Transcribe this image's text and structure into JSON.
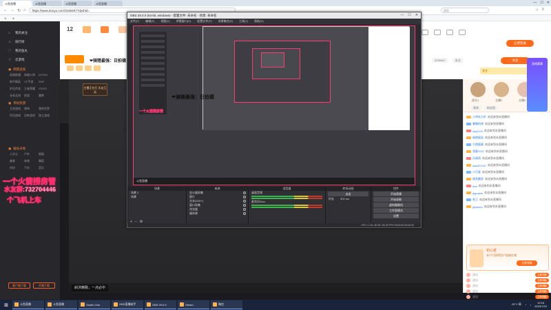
{
  "browser": {
    "tabs": [
      "斗鱼直播",
      "斗鱼直播",
      "斗鱼直播",
      "斗鱼直播"
    ],
    "url": "https://www.douyu.com/3236467?dyshid=",
    "search_placeholder": "搜索",
    "controls": [
      "—",
      "☐",
      "✕"
    ]
  },
  "sidebar": {
    "items": [
      {
        "icon": "home-icon",
        "label": "我的关注"
      },
      {
        "icon": "fire-icon",
        "label": "排行榜"
      },
      {
        "icon": "heart-icon",
        "label": "我的鱼丸"
      },
      {
        "icon": "star-icon",
        "label": "云游戏"
      }
    ],
    "section1": "网游竞技",
    "grid1": [
      "英雄联盟",
      "穿越火线",
      "DOTA2",
      "和平精英",
      "CF手游",
      "DNF",
      "炉石传说",
      "王者荣耀",
      "CSGO",
      "永劫无间",
      "逆战",
      "魔兽"
    ],
    "section2": "单机热游",
    "grid2": [
      "主机游戏",
      "原神",
      "我的世界",
      "怀旧游戏",
      "恐怖游戏",
      "独立游戏"
    ],
    "section3": "娱乐天地",
    "grid3": [
      "二次元",
      "户外",
      "颜值",
      "美食",
      "体育",
      "舞蹈",
      "科技",
      "汽车",
      "音乐"
    ],
    "bottom_buttons": [
      "客户端下载",
      "开播下载"
    ]
  },
  "header": {
    "nav_number": "12",
    "room_title": "❤骑猪最强：日拍德",
    "login": "立即登录",
    "follow": "关注",
    "anchor_chip": "关注",
    "room_code": "3236467"
  },
  "overlay": {
    "line1": "一个火箭捞房管",
    "line2": "水友群:732704446",
    "line3": "个飞机上车",
    "anchor_tag": "主播正在打\n水友互动"
  },
  "obs": {
    "title": "OBS 29.0.0 (64-bit, windows) - 配置文件: 未命名 - 场景: 未命名",
    "menu": [
      "文件(F)",
      "编辑(E)",
      "视图(V)",
      "停靠窗口(D)",
      "配置文件(P)",
      "场景集合(S)",
      "工具(T)",
      "帮助(H)"
    ],
    "docks": {
      "scenes": {
        "title": "场景",
        "items": [
          "场景 2",
          "场景"
        ]
      },
      "sources": {
        "title": "来源",
        "items": [
          "显示器采集",
          "图片",
          "文本(GDI+)",
          "窗口采集",
          "浏览器",
          "媒体源"
        ]
      },
      "mixer": {
        "title": "混音器",
        "items": [
          "桌面音频",
          "麦克风/Aux"
        ]
      },
      "transitions": {
        "title": "转场动画",
        "items": [
          "淡出",
          "时长",
          "300 ms"
        ]
      },
      "controls": {
        "title": "控件",
        "items": [
          "开始直播",
          "开始录制",
          "虚拟摄像机",
          "工作室模式",
          "设置",
          "退出"
        ]
      }
    },
    "status": "CPU: 1.2%, 60.00 / 60.00 FPS   00:00:00   00:00:00"
  },
  "preview": {
    "title": "❤骑猪最强：日拍德",
    "bottom": "斗鱼直播"
  },
  "player": {
    "tip": "斜沐精致，一点必中"
  },
  "right": {
    "rank": [
      "虎牙1",
      "主播2",
      "主播3"
    ],
    "chips": [
      "贵宾",
      "粉丝团"
    ],
    "chat": [
      {
        "lvl": "a",
        "name": "小鸡吃大虾",
        "msg": "欢迎来到本直播间"
      },
      {
        "lvl": "b",
        "name": "暴躁的夜",
        "msg": "欢迎来到直播间"
      },
      {
        "lvl": "r",
        "name": "sky0123",
        "msg": "欢迎来到本直播间"
      },
      {
        "lvl": "a",
        "name": "暗夜星辰",
        "msg": "欢迎来到本直播间"
      },
      {
        "lvl": "b",
        "name": "大炮轰轰",
        "msg": "欢迎来到本直播间"
      },
      {
        "lvl": "a",
        "name": "游客2021",
        "msg": "欢迎来到本直播间"
      },
      {
        "lvl": "r",
        "name": "风清扬",
        "msg": "欢迎来到本直播间"
      },
      {
        "lvl": "a",
        "name": "aaa321321",
        "msg": "欢迎来到本直播间"
      },
      {
        "lvl": "b",
        "name": "小可爱",
        "msg": "欢迎来到本直播间"
      },
      {
        "lvl": "a",
        "name": "咸鱼翻身",
        "msg": "欢迎来到本直播间"
      },
      {
        "lvl": "r",
        "name": "ddd",
        "msg": "欢迎来到本直播间"
      },
      {
        "lvl": "a",
        "name": "qiguaide",
        "msg": "欢迎来到本直播间"
      },
      {
        "lvl": "b",
        "name": "老王",
        "msg": "欢迎来到本直播间"
      },
      {
        "lvl": "a",
        "name": "jdywmhr",
        "msg": "欢迎来到本直播间"
      }
    ],
    "gift_pop": {
      "title": "初心者",
      "text": "本户可获得用户超越礼物",
      "btn": "立即领取"
    },
    "gift_rows": [
      "送出",
      "送出",
      "送出",
      "送出",
      "送出"
    ],
    "gift_btn": "立即领取",
    "float": "游戏赛事"
  },
  "taskbar": {
    "items": [
      "斗鱼直播",
      "斗鱼直播",
      "Studio One",
      "OBS直播助手",
      "OBS 29.0.0",
      "Steam",
      "微信"
    ],
    "weather": "28°C 晴",
    "time": "12:16",
    "date": "2023/7/22"
  },
  "colors": {
    "accent": "#ff6a1a",
    "obs_highlight": "#ff3c6e",
    "taskbar": "#19233a"
  }
}
